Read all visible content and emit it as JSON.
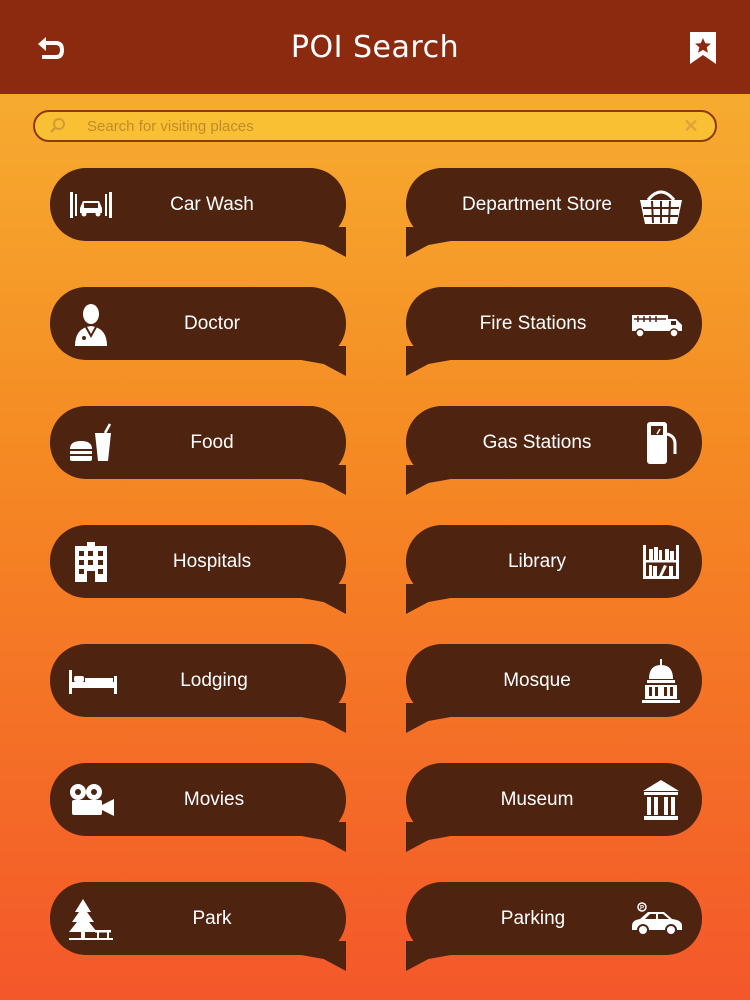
{
  "header": {
    "title": "POI Search",
    "back_icon": "back-arrow-icon",
    "bookmark_icon": "bookmark-star-icon"
  },
  "search": {
    "placeholder": "Search for visiting places",
    "value": ""
  },
  "colors": {
    "header_bg": "#8c2a10",
    "tile_bg": "#4e2310",
    "gradient_top": "#f6b433",
    "gradient_bottom": "#f4572a"
  },
  "categories": [
    {
      "label": "Car Wash",
      "icon": "car-wash-icon"
    },
    {
      "label": "Department Store",
      "icon": "basket-icon"
    },
    {
      "label": "Doctor",
      "icon": "doctor-icon"
    },
    {
      "label": "Fire Stations",
      "icon": "fire-truck-icon"
    },
    {
      "label": "Food",
      "icon": "burger-drink-icon"
    },
    {
      "label": "Gas Stations",
      "icon": "fuel-pump-icon"
    },
    {
      "label": "Hospitals",
      "icon": "hospital-building-icon"
    },
    {
      "label": "Library",
      "icon": "bookshelf-icon"
    },
    {
      "label": "Lodging",
      "icon": "bed-icon"
    },
    {
      "label": "Mosque",
      "icon": "dome-icon"
    },
    {
      "label": "Movies",
      "icon": "movie-camera-icon"
    },
    {
      "label": "Museum",
      "icon": "museum-icon"
    },
    {
      "label": "Park",
      "icon": "tree-bench-icon"
    },
    {
      "label": "Parking",
      "icon": "parked-car-icon"
    }
  ]
}
